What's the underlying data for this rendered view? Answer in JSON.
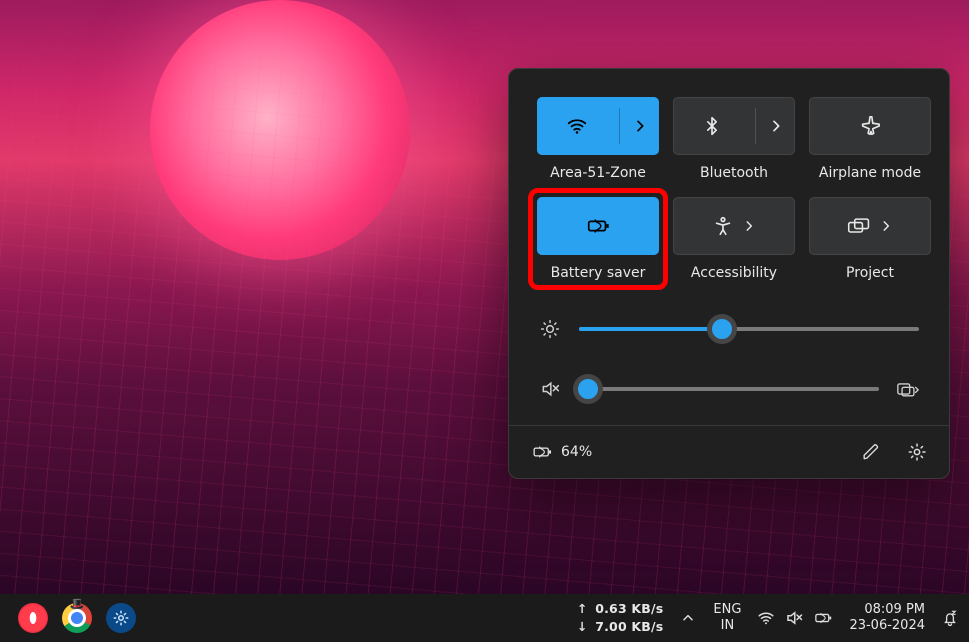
{
  "quick_settings": {
    "tiles": {
      "wifi": {
        "label": "Area-51-Zone",
        "active": true
      },
      "bluetooth": {
        "label": "Bluetooth",
        "active": false
      },
      "airplane": {
        "label": "Airplane mode",
        "active": false
      },
      "battery": {
        "label": "Battery saver",
        "active": true
      },
      "a11y": {
        "label": "Accessibility",
        "active": false
      },
      "project": {
        "label": "Project",
        "active": false
      }
    },
    "sliders": {
      "brightness_pct": 42,
      "volume_pct": 3
    },
    "footer": {
      "battery_text": "64%"
    }
  },
  "taskbar": {
    "net_up": "0.63 KB/s",
    "net_down": "7.00 KB/s",
    "lang_top": "ENG",
    "lang_bottom": "IN",
    "time": "08:09 PM",
    "date": "23-06-2024"
  },
  "icons": {
    "wifi": "wifi-icon",
    "bluetooth": "bluetooth-icon",
    "airplane": "airplane-icon",
    "battery_saver": "battery-saver-icon",
    "accessibility": "accessibility-icon",
    "project": "project-icon",
    "chevron_right": "chevron-right-icon",
    "chevron_up": "chevron-up-icon",
    "brightness": "brightness-icon",
    "volume_muted": "volume-muted-icon",
    "audio_out": "audio-output-icon",
    "pencil": "pencil-icon",
    "gear": "gear-icon",
    "arrow_up": "arrow-up-icon",
    "arrow_down": "arrow-down-icon",
    "notification": "notification-snooze-icon"
  }
}
